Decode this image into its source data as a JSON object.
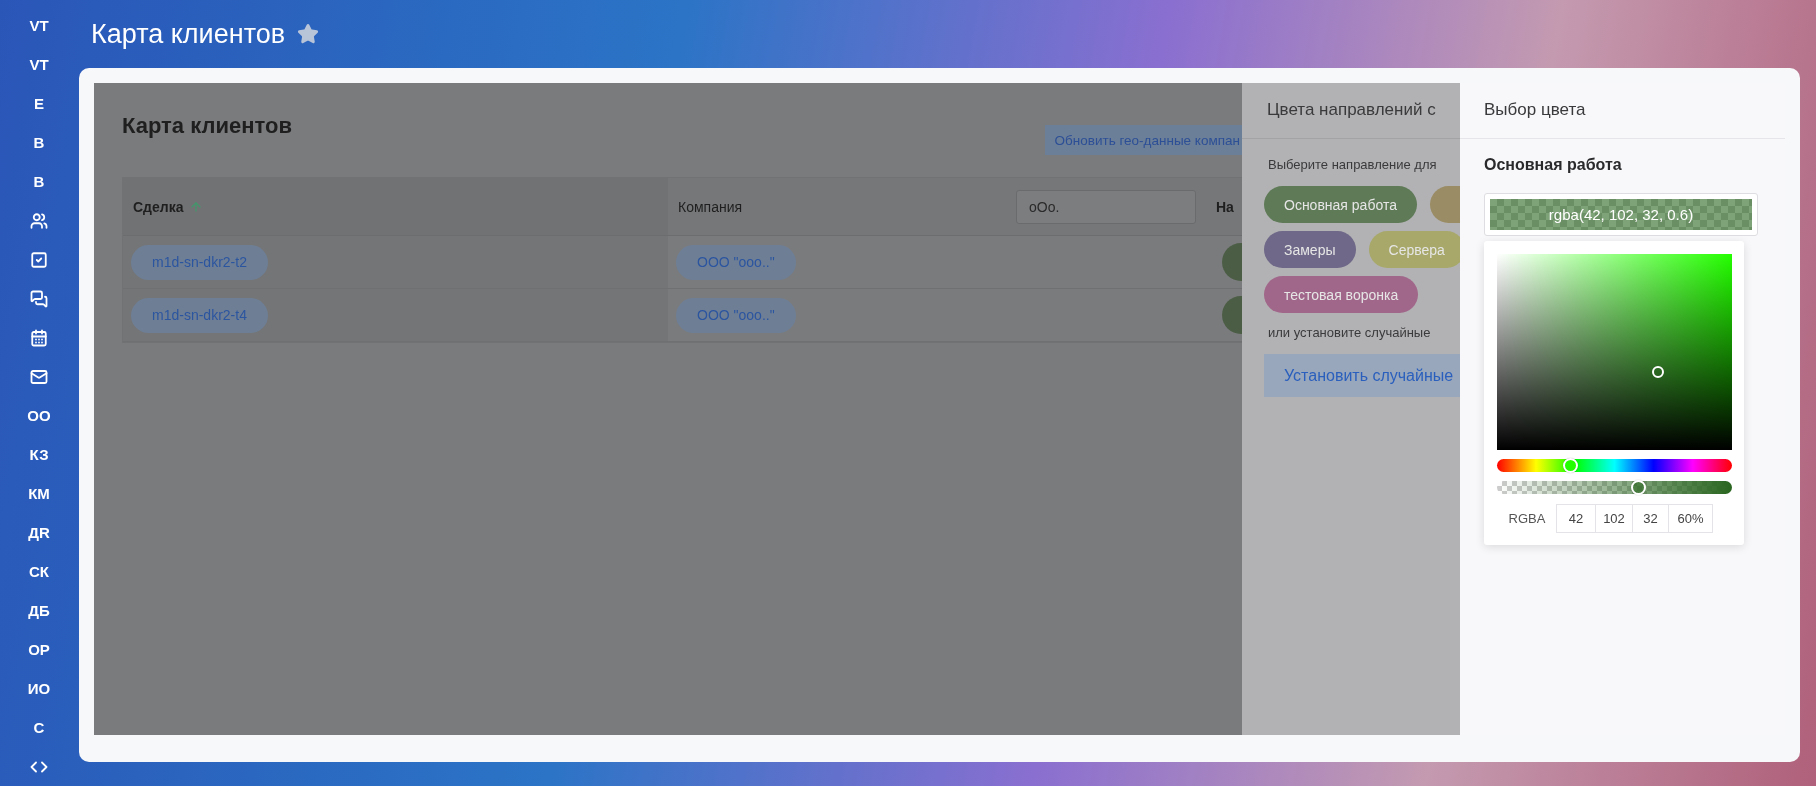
{
  "page": {
    "title": "Карта клиентов"
  },
  "sidebar": {
    "items": [
      {
        "kind": "label",
        "label": "VT"
      },
      {
        "kind": "label",
        "label": "VT"
      },
      {
        "kind": "label",
        "label": "Е"
      },
      {
        "kind": "label",
        "label": "В"
      },
      {
        "kind": "label",
        "label": "В"
      },
      {
        "kind": "people"
      },
      {
        "kind": "task"
      },
      {
        "kind": "chat"
      },
      {
        "kind": "calendar"
      },
      {
        "kind": "mail"
      },
      {
        "kind": "label",
        "label": "ОО"
      },
      {
        "kind": "label",
        "label": "КЗ"
      },
      {
        "kind": "label",
        "label": "КМ"
      },
      {
        "kind": "label",
        "label": "ДR"
      },
      {
        "kind": "label",
        "label": "СК"
      },
      {
        "kind": "label",
        "label": "ДБ"
      },
      {
        "kind": "label",
        "label": "ОР"
      },
      {
        "kind": "label",
        "label": "ИО"
      },
      {
        "kind": "label",
        "label": "С"
      },
      {
        "kind": "code"
      }
    ]
  },
  "map_page": {
    "title": "Карта клиентов",
    "update_button": "Обновить гео-данные компан",
    "table": {
      "columns": [
        {
          "label": "Сделка",
          "sorted": true
        },
        {
          "label": "Компания"
        },
        {
          "kind": "filter",
          "value": "oOo."
        },
        {
          "label": "На"
        }
      ],
      "rows": [
        {
          "deal": "m1d-sn-dkr2-t2",
          "company": "ООО \"ooo..\""
        },
        {
          "deal": "m1d-sn-dkr2-t4",
          "company": "ООО \"ooo..\""
        }
      ]
    }
  },
  "directions_panel": {
    "title": "Цвета направлений с",
    "prompt": "Выберите направление для",
    "directions": [
      {
        "label": "Основная работа",
        "color": "#5f7a57"
      },
      {
        "color": "#9a8c64"
      },
      {
        "label": "Замеры",
        "color": "#6f6888"
      },
      {
        "label": "Сервера",
        "color": "#a7a86a"
      },
      {
        "label": "тестовая воронка",
        "color": "#a1678a"
      }
    ],
    "random_prompt": "или установите случайные",
    "random_button": "Установить случайные"
  },
  "color_panel": {
    "title": "Выбор цвета",
    "direction": "Основная работа",
    "value": "rgba(42, 102, 32, 0.6)",
    "hue_slider": {
      "level": 0.31
    },
    "alpha_slider": {
      "level": 0.6
    },
    "format": "RGBA",
    "channels": [
      "42",
      "102",
      "32",
      "60%"
    ]
  }
}
